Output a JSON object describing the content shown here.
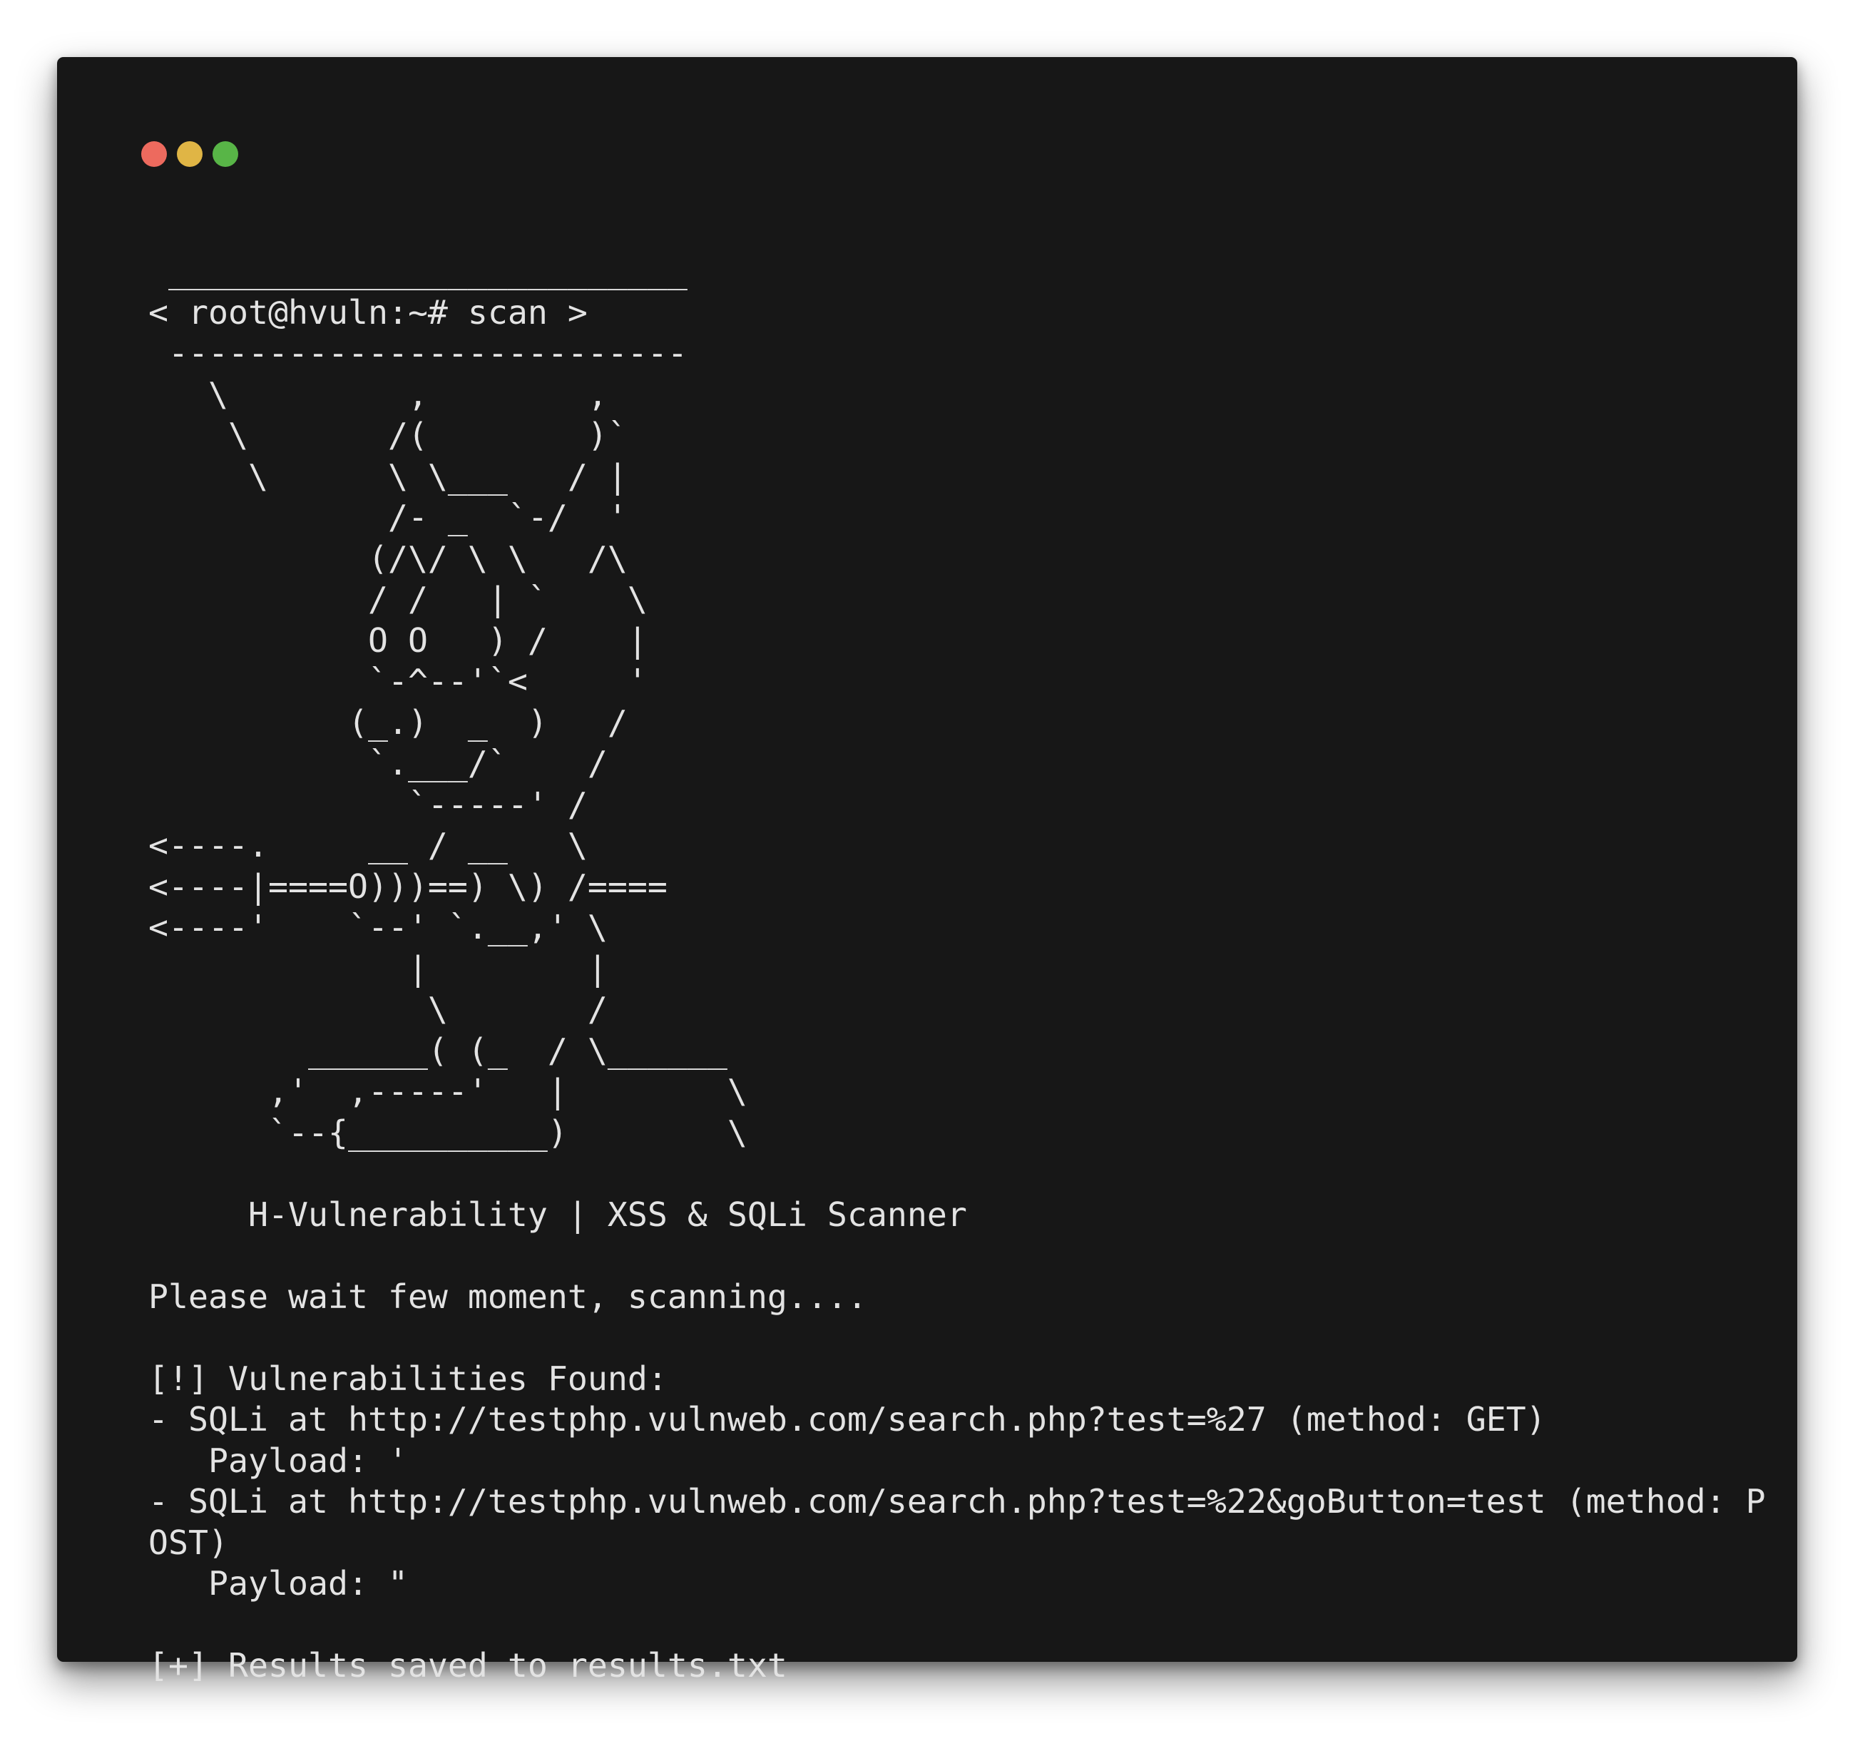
{
  "window": {
    "controls": [
      {
        "name": "close",
        "color": "#ed6a5e"
      },
      {
        "name": "minimize",
        "color": "#e0b545"
      },
      {
        "name": "zoom",
        "color": "#58b547"
      }
    ],
    "foreground_color": "#e3e3e3",
    "background_color": "#171717"
  },
  "terminal": {
    "lines": [
      " __________________________",
      "< root@hvuln:~# scan >",
      " --------------------------",
      "   \\         ,        ,",
      "    \\       /(        )`",
      "     \\      \\ \\___   / |",
      "            /- _  `-/  '",
      "           (/\\/ \\ \\   /\\",
      "           / /   | `    \\",
      "           O O   ) /    |",
      "           `-^--'`<     '",
      "          (_.)  _  )   /",
      "           `.___/`    /",
      "             `-----' /",
      "<----.     __ / __   \\",
      "<----|====O)))==) \\) /====",
      "<----'    `--' `.__,' \\",
      "             |        |",
      "              \\       /",
      "        ______( (_  / \\______",
      "      ,'  ,-----'   |        \\",
      "      `--{__________)        \\",
      "",
      "     H-Vulnerability | XSS & SQLi Scanner",
      "",
      "Please wait few moment, scanning....",
      "",
      "[!] Vulnerabilities Found:",
      "- SQLi at http://testphp.vulnweb.com/search.php?test=%27 (method: GET)",
      "   Payload: '",
      "- SQLi at http://testphp.vulnweb.com/search.php?test=%22&goButton=test (method: P",
      "OST)",
      "   Payload: \"",
      "",
      "[+] Results saved to results.txt"
    ]
  }
}
